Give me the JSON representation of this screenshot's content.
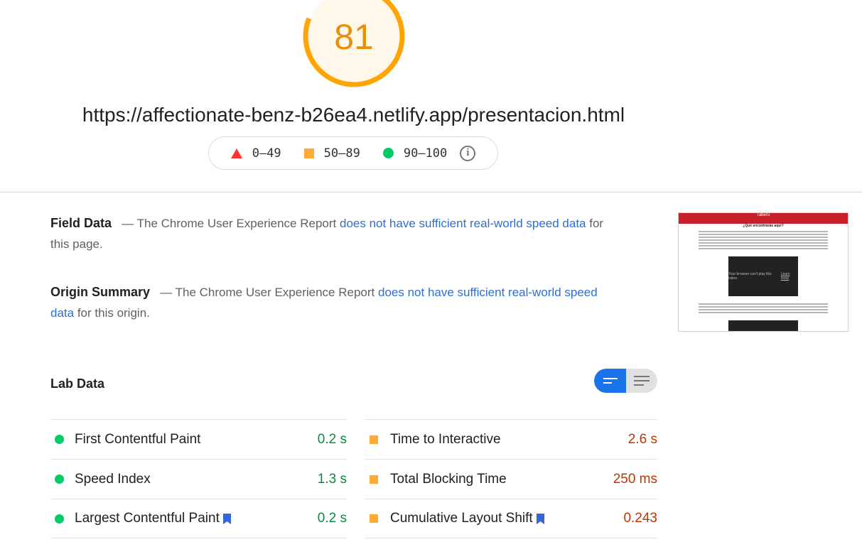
{
  "score": {
    "value": "81",
    "fraction": 0.81,
    "color": "#ffa400"
  },
  "url": "https://affectionate-benz-b26ea4.netlify.app/presentacion.html",
  "legend": [
    {
      "icon": "triangle-icon",
      "label": "0–49",
      "color": "#ff3333"
    },
    {
      "icon": "square-icon",
      "label": "50–89",
      "color": "#ffaa33"
    },
    {
      "icon": "circle-icon",
      "label": "90–100",
      "color": "#00cc66"
    }
  ],
  "field_data": {
    "title": "Field Data",
    "dash": "—",
    "prefix": "The Chrome User Experience Report",
    "link": "does not have sufficient real-world speed data",
    "suffix": "for this page."
  },
  "origin_summary": {
    "title": "Origin Summary",
    "dash": "—",
    "prefix": "The Chrome User Experience Report",
    "link": "does not have sufficient real-world speed data",
    "suffix": "for this origin."
  },
  "lab_data": {
    "title": "Lab Data",
    "left": [
      {
        "label": "First Contentful Paint",
        "value": "0.2 s",
        "status": "good",
        "bookmark": false
      },
      {
        "label": "Speed Index",
        "value": "1.3 s",
        "status": "good",
        "bookmark": false
      },
      {
        "label": "Largest Contentful Paint",
        "value": "0.2 s",
        "status": "good",
        "bookmark": true
      }
    ],
    "right": [
      {
        "label": "Time to Interactive",
        "value": "2.6 s",
        "status": "average",
        "bookmark": false
      },
      {
        "label": "Total Blocking Time",
        "value": "250 ms",
        "status": "average",
        "bookmark": false
      },
      {
        "label": "Cumulative Layout Shift",
        "value": "0.243",
        "status": "average",
        "bookmark": true
      }
    ]
  },
  "thumbnail": {
    "header_title": "Taberu",
    "subtitle": "¿Qué encontrarás aquí?",
    "video_text": "Your browser can't play this video.",
    "video_link": "Learn more"
  },
  "colors": {
    "accent_blue": "#1a73e8",
    "good": "#0cce6b",
    "average": "#ffa400",
    "link": "#2f6fd0"
  }
}
